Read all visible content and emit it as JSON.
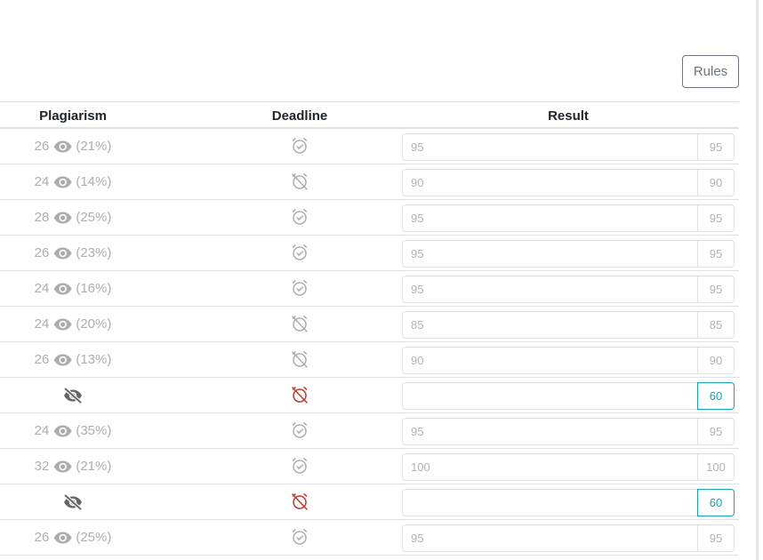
{
  "toolbar": {
    "rules_label": "Rules"
  },
  "table": {
    "headers": {
      "plagiarism": "Plagiarism",
      "deadline": "Deadline",
      "result": "Result"
    },
    "rows": [
      {
        "plagiarism_count": "26",
        "plagiarism_pct": "(21%)",
        "hidden": false,
        "deadline": "ok",
        "result_value": "95",
        "result_score": "95",
        "active": false
      },
      {
        "plagiarism_count": "24",
        "plagiarism_pct": "(14%)",
        "hidden": false,
        "deadline": "off",
        "result_value": "90",
        "result_score": "90",
        "active": false
      },
      {
        "plagiarism_count": "28",
        "plagiarism_pct": "(25%)",
        "hidden": false,
        "deadline": "ok",
        "result_value": "95",
        "result_score": "95",
        "active": false
      },
      {
        "plagiarism_count": "26",
        "plagiarism_pct": "(23%)",
        "hidden": false,
        "deadline": "ok",
        "result_value": "95",
        "result_score": "95",
        "active": false
      },
      {
        "plagiarism_count": "24",
        "plagiarism_pct": "(16%)",
        "hidden": false,
        "deadline": "ok",
        "result_value": "95",
        "result_score": "95",
        "active": false
      },
      {
        "plagiarism_count": "24",
        "plagiarism_pct": "(20%)",
        "hidden": false,
        "deadline": "off",
        "result_value": "85",
        "result_score": "85",
        "active": false
      },
      {
        "plagiarism_count": "26",
        "plagiarism_pct": "(13%)",
        "hidden": false,
        "deadline": "off",
        "result_value": "90",
        "result_score": "90",
        "active": false
      },
      {
        "plagiarism_count": "",
        "plagiarism_pct": "",
        "hidden": true,
        "deadline": "missed",
        "result_value": "",
        "result_score": "60",
        "active": true
      },
      {
        "plagiarism_count": "24",
        "plagiarism_pct": "(35%)",
        "hidden": false,
        "deadline": "ok",
        "result_value": "95",
        "result_score": "95",
        "active": false
      },
      {
        "plagiarism_count": "32",
        "plagiarism_pct": "(21%)",
        "hidden": false,
        "deadline": "ok",
        "result_value": "100",
        "result_score": "100",
        "active": false
      },
      {
        "plagiarism_count": "",
        "plagiarism_pct": "",
        "hidden": true,
        "deadline": "missed",
        "result_value": "",
        "result_score": "60",
        "active": true
      },
      {
        "plagiarism_count": "26",
        "plagiarism_pct": "(25%)",
        "hidden": false,
        "deadline": "ok",
        "result_value": "95",
        "result_score": "95",
        "active": false
      }
    ]
  },
  "colors": {
    "muted": "#adadad",
    "missed": "#c0392b",
    "accent": "#17a2b8",
    "hidden_eye": "#666666"
  }
}
